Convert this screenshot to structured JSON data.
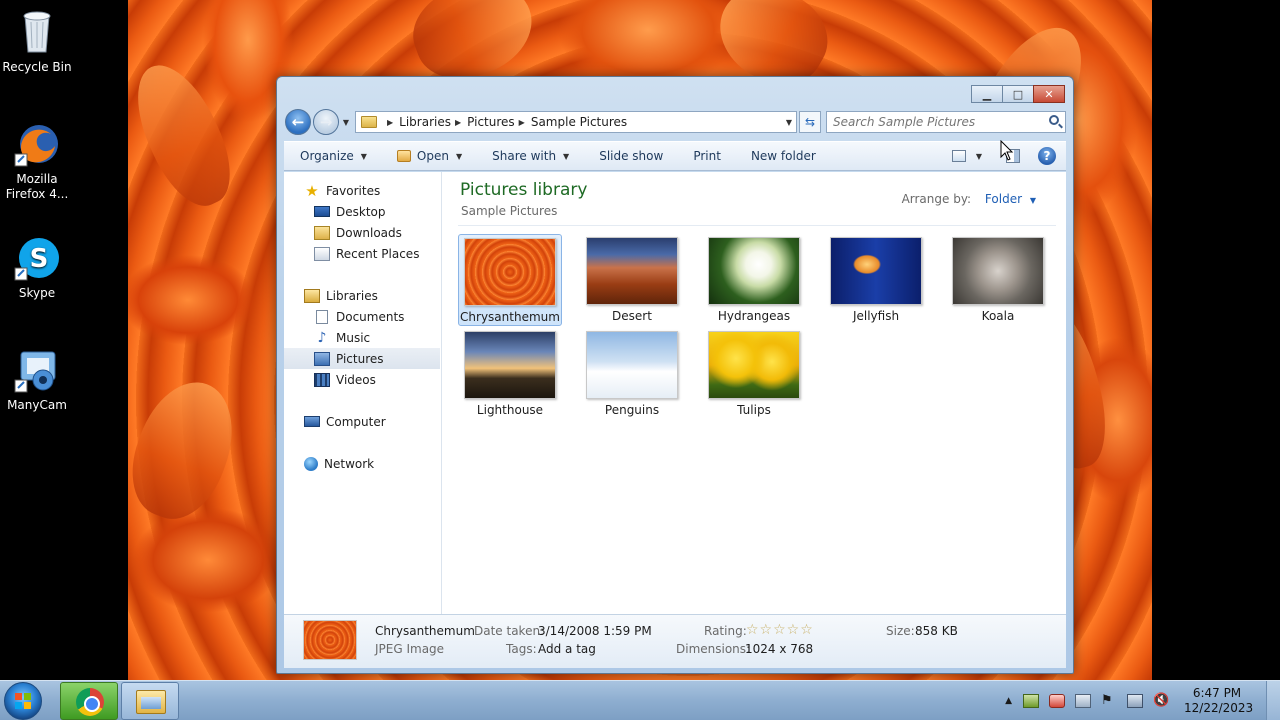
{
  "desktop": {
    "icons": [
      {
        "label": "Recycle Bin",
        "icon": "recycle-bin-icon"
      },
      {
        "label": "Mozilla Firefox 4...",
        "icon": "firefox-icon"
      },
      {
        "label": "Skype",
        "icon": "skype-icon"
      },
      {
        "label": "ManyCam",
        "icon": "manycam-icon"
      }
    ]
  },
  "window": {
    "address": {
      "crumbs": [
        "Libraries",
        "Pictures",
        "Sample Pictures"
      ]
    },
    "search": {
      "placeholder": "Search Sample Pictures"
    },
    "toolbar": {
      "organize": "Organize",
      "open": "Open",
      "share_with": "Share with",
      "slide_show": "Slide show",
      "print": "Print",
      "new_folder": "New folder"
    },
    "nav_pane": {
      "favorites": "Favorites",
      "desktop": "Desktop",
      "downloads": "Downloads",
      "recent_places": "Recent Places",
      "libraries": "Libraries",
      "documents": "Documents",
      "music": "Music",
      "pictures": "Pictures",
      "videos": "Videos",
      "computer": "Computer",
      "network": "Network"
    },
    "main": {
      "title": "Pictures library",
      "subtitle": "Sample Pictures",
      "arrange_label": "Arrange by:",
      "arrange_value": "Folder",
      "items": [
        {
          "name": "Chrysanthemum",
          "selected": true
        },
        {
          "name": "Desert"
        },
        {
          "name": "Hydrangeas"
        },
        {
          "name": "Jellyfish"
        },
        {
          "name": "Koala"
        },
        {
          "name": "Lighthouse"
        },
        {
          "name": "Penguins"
        },
        {
          "name": "Tulips"
        }
      ]
    },
    "details": {
      "name": "Chrysanthemum",
      "type": "JPEG Image",
      "date_taken_label": "Date taken:",
      "date_taken": "3/14/2008 1:59 PM",
      "tags_label": "Tags:",
      "tags": "Add a tag",
      "rating_label": "Rating:",
      "rating_stars": 0,
      "rating_max": 5,
      "dimensions_label": "Dimensions:",
      "dimensions": "1024 x 768",
      "size_label": "Size:",
      "size": "858 KB"
    }
  },
  "taskbar": {
    "apps": [
      {
        "name": "Google Chrome",
        "icon": "chrome-icon"
      },
      {
        "name": "Windows Explorer",
        "icon": "explorer-icon"
      }
    ],
    "clock": {
      "time": "6:47 PM",
      "date": "12/22/2023"
    }
  }
}
